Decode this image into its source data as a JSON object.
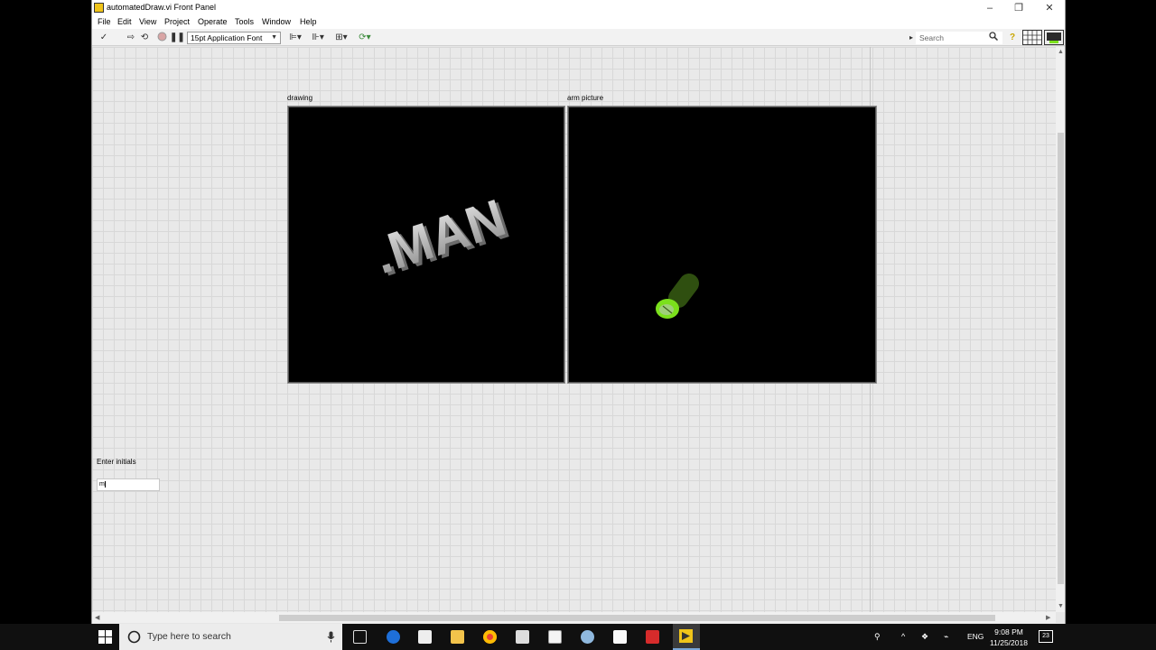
{
  "window": {
    "title": "automatedDraw.vi Front Panel"
  },
  "menu": [
    "File",
    "Edit",
    "View",
    "Project",
    "Operate",
    "Tools",
    "Window",
    "Help"
  ],
  "toolbar": {
    "font": "15pt Application Font",
    "search_placeholder": "Search"
  },
  "panel": {
    "drawing_label": "drawing",
    "drawing_text": ".MAN",
    "arm_label": "arm picture",
    "initials_label": "Enter initials",
    "initials_value": "m"
  },
  "taskbar": {
    "search_placeholder": "Type here to search",
    "language": "ENG",
    "time": "9:08 PM",
    "date": "11/25/2018",
    "notification_count": "23"
  },
  "colors": {
    "arm_green": "#7be01c",
    "canvas_bg": "#000000"
  }
}
